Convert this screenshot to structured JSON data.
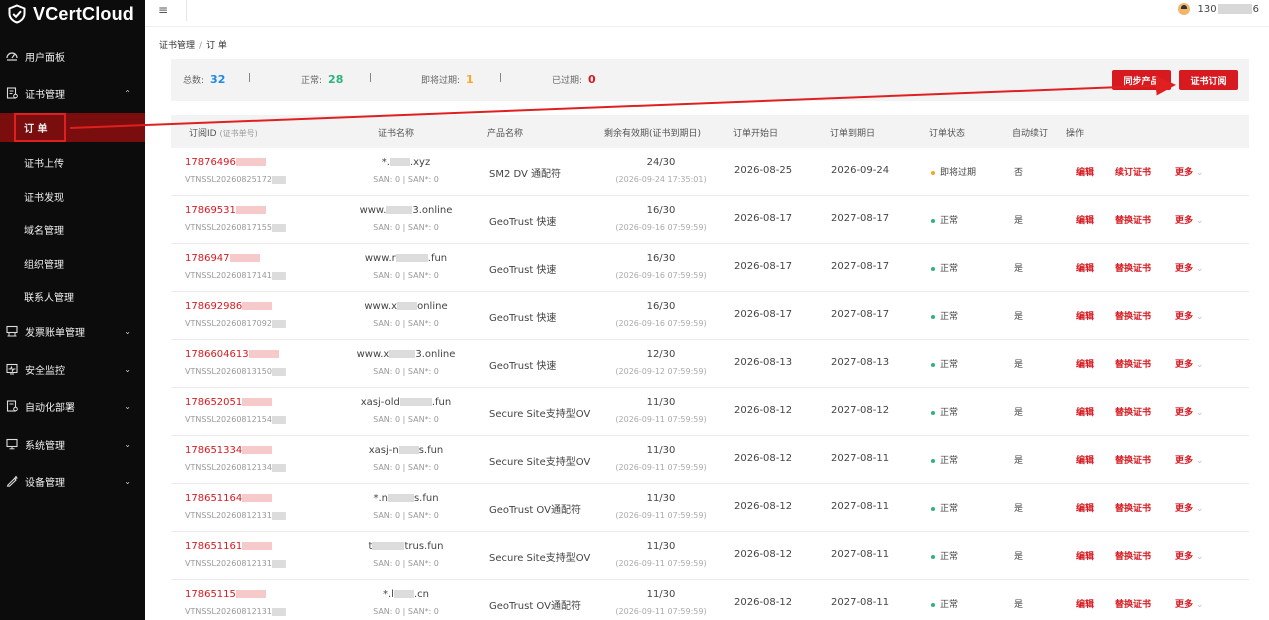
{
  "brand": {
    "name": "VCertCloud"
  },
  "header": {
    "user_prefix": "130",
    "user_suffix": "6"
  },
  "sidebar": {
    "items": [
      {
        "label": "用户面板",
        "icon": "dashboard-icon"
      },
      {
        "label": "证书管理",
        "icon": "certificate-icon"
      },
      {
        "label": "发票账单管理",
        "icon": "invoice-icon"
      },
      {
        "label": "安全监控",
        "icon": "monitor-icon"
      },
      {
        "label": "自动化部署",
        "icon": "deploy-icon"
      },
      {
        "label": "系统管理",
        "icon": "system-icon"
      },
      {
        "label": "设备管理",
        "icon": "device-icon"
      }
    ],
    "sub_items": [
      {
        "label": "订 单"
      },
      {
        "label": "证书上传"
      },
      {
        "label": "证书发现"
      },
      {
        "label": "域名管理"
      },
      {
        "label": "组织管理"
      },
      {
        "label": "联系人管理"
      }
    ]
  },
  "breadcrumb": {
    "parent": "证书管理",
    "sep": "/",
    "current": "订 单"
  },
  "summary": {
    "total_label": "总数:",
    "total": "32",
    "normal_label": "正常:",
    "normal": "28",
    "expiring_label": "即将过期:",
    "expiring": "1",
    "expired_label": "已过期:",
    "expired": "0",
    "sep": "|",
    "sync_button": "同步产品",
    "subscribe_button": "证书订阅"
  },
  "table": {
    "headers": {
      "order_id": "订阅ID",
      "order_id_sub": "(证书单号)",
      "cert_name": "证书名称",
      "product": "产品名称",
      "remaining": "剩余有效期(证书到期日)",
      "start": "订单开始日",
      "end": "订单到期日",
      "status": "订单状态",
      "auto": "自动续订",
      "ops": "操作"
    },
    "rows": [
      {
        "id": "17876496",
        "sub": "VTNSSL20260825172",
        "domain_a": "*.",
        "domain_b": ".xyz",
        "san": "SAN: 0 | SAN*: 0",
        "product": "SM2 DV 通配符",
        "remain": "24/30",
        "remain_date": "(2026-09-24 17:35:01)",
        "start": "2026-08-25",
        "end": "2026-09-24",
        "status": "即将过期",
        "status_color": "#f5a623",
        "auto": "否",
        "op1": "编辑",
        "op2": "续订证书",
        "op3": "更多"
      },
      {
        "id": "17869531",
        "sub": "VTNSSL20260817155",
        "domain_a": "www.",
        "domain_b": "3.online",
        "san": "SAN: 0 | SAN*: 0",
        "product": "GeoTrust 快速",
        "remain": "16/30",
        "remain_date": "(2026-09-16 07:59:59)",
        "start": "2026-08-17",
        "end": "2027-08-17",
        "status": "正常",
        "status_color": "#2db37a",
        "auto": "是",
        "op1": "编辑",
        "op2": "替换证书",
        "op3": "更多"
      },
      {
        "id": "1786947",
        "sub": "VTNSSL20260817141",
        "domain_a": "www.r",
        "domain_b": ".fun",
        "san": "SAN: 0 | SAN*: 0",
        "product": "GeoTrust 快速",
        "remain": "16/30",
        "remain_date": "(2026-09-16 07:59:59)",
        "start": "2026-08-17",
        "end": "2027-08-17",
        "status": "正常",
        "status_color": "#2db37a",
        "auto": "是",
        "op1": "编辑",
        "op2": "替换证书",
        "op3": "更多"
      },
      {
        "id": "178692986",
        "sub": "VTNSSL20260817092",
        "domain_a": "www.x",
        "domain_b": "online",
        "san": "SAN: 0 | SAN*: 0",
        "product": "GeoTrust 快速",
        "remain": "16/30",
        "remain_date": "(2026-09-16 07:59:59)",
        "start": "2026-08-17",
        "end": "2027-08-17",
        "status": "正常",
        "status_color": "#2db37a",
        "auto": "是",
        "op1": "编辑",
        "op2": "替换证书",
        "op3": "更多"
      },
      {
        "id": "1786604613",
        "sub": "VTNSSL20260813150",
        "domain_a": "www.x",
        "domain_b": "3.online",
        "san": "SAN: 0 | SAN*: 0",
        "product": "GeoTrust 快速",
        "remain": "12/30",
        "remain_date": "(2026-09-12 07:59:59)",
        "start": "2026-08-13",
        "end": "2027-08-13",
        "status": "正常",
        "status_color": "#2db37a",
        "auto": "是",
        "op1": "编辑",
        "op2": "替换证书",
        "op3": "更多"
      },
      {
        "id": "178652051",
        "sub": "VTNSSL20260812154",
        "domain_a": "xasj-old",
        "domain_b": ".fun",
        "san": "SAN: 0 | SAN*: 0",
        "product": "Secure Site支持型OV",
        "remain": "11/30",
        "remain_date": "(2026-09-11 07:59:59)",
        "start": "2026-08-12",
        "end": "2027-08-12",
        "status": "正常",
        "status_color": "#2db37a",
        "auto": "是",
        "op1": "编辑",
        "op2": "替换证书",
        "op3": "更多"
      },
      {
        "id": "178651334",
        "sub": "VTNSSL20260812134",
        "domain_a": "xasj-n",
        "domain_b": "s.fun",
        "san": "SAN: 0 | SAN*: 0",
        "product": "Secure Site支持型OV",
        "remain": "11/30",
        "remain_date": "(2026-09-11 07:59:59)",
        "start": "2026-08-12",
        "end": "2027-08-11",
        "status": "正常",
        "status_color": "#2db37a",
        "auto": "是",
        "op1": "编辑",
        "op2": "替换证书",
        "op3": "更多"
      },
      {
        "id": "178651164",
        "sub": "VTNSSL20260812131",
        "domain_a": "*.n",
        "domain_b": "s.fun",
        "san": "SAN: 0 | SAN*: 0",
        "product": "GeoTrust OV通配符",
        "remain": "11/30",
        "remain_date": "(2026-09-11 07:59:59)",
        "start": "2026-08-12",
        "end": "2027-08-11",
        "status": "正常",
        "status_color": "#2db37a",
        "auto": "是",
        "op1": "编辑",
        "op2": "替换证书",
        "op3": "更多"
      },
      {
        "id": "178651161",
        "sub": "VTNSSL20260812131",
        "domain_a": "t",
        "domain_b": "trus.fun",
        "san": "SAN: 0 | SAN*: 0",
        "product": "Secure Site支持型OV",
        "remain": "11/30",
        "remain_date": "(2026-09-11 07:59:59)",
        "start": "2026-08-12",
        "end": "2027-08-11",
        "status": "正常",
        "status_color": "#2db37a",
        "auto": "是",
        "op1": "编辑",
        "op2": "替换证书",
        "op3": "更多"
      },
      {
        "id": "17865115",
        "sub": "VTNSSL20260812131",
        "domain_a": "*.l",
        "domain_b": ".cn",
        "san": "SAN: 0 | SAN*: 0",
        "product": "GeoTrust OV通配符",
        "remain": "11/30",
        "remain_date": "(2026-09-11 07:59:59)",
        "start": "2026-08-12",
        "end": "2027-08-11",
        "status": "正常",
        "status_color": "#2db37a",
        "auto": "是",
        "op1": "编辑",
        "op2": "替换证书",
        "op3": "更多"
      }
    ]
  },
  "colors": {
    "accent": "#d71920",
    "sidebar_bg": "#0c0c0c",
    "annotation": "#e02020"
  }
}
